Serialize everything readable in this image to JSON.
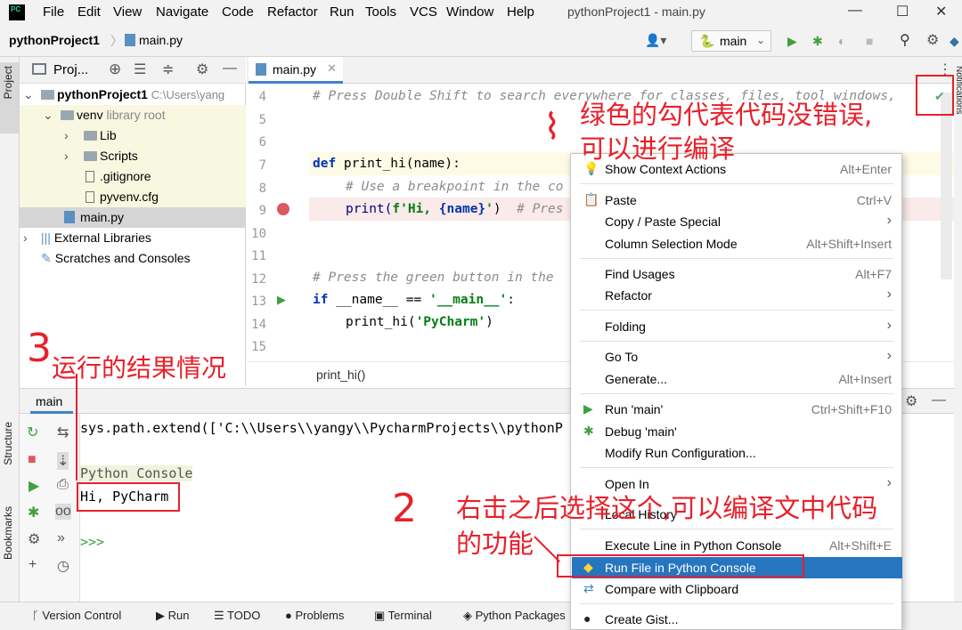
{
  "app": {
    "logo": "PC",
    "title": "pythonProject1 - main.py"
  },
  "menu": [
    "File",
    "Edit",
    "View",
    "Navigate",
    "Code",
    "Refactor",
    "Run",
    "Tools",
    "VCS",
    "Window",
    "Help"
  ],
  "window_controls": {
    "minimize": "—",
    "maximize": "☐",
    "close": "✕"
  },
  "navbar": {
    "project": "pythonProject1",
    "file": "main.py",
    "run_config": "main"
  },
  "sidebar_left": {
    "project_tab": "Project",
    "structure_tab": "Structure",
    "bookmarks_tab": "Bookmarks"
  },
  "sidebar_right": {
    "notifications_tab": "Notifications"
  },
  "project_panel": {
    "title": "Proj...",
    "tree": [
      {
        "label": "pythonProject1",
        "extra": "C:\\Users\\yang"
      },
      {
        "label": "venv",
        "extra": "library root"
      },
      {
        "label": "Lib"
      },
      {
        "label": "Scripts"
      },
      {
        "label": ".gitignore"
      },
      {
        "label": "pyvenv.cfg"
      },
      {
        "label": "main.py"
      },
      {
        "label": "External Libraries"
      },
      {
        "label": "Scratches and Consoles"
      }
    ]
  },
  "editor": {
    "tab": "main.py",
    "line_numbers": [
      "4",
      "5",
      "6",
      "7",
      "8",
      "9",
      "10",
      "11",
      "12",
      "13",
      "14",
      "15"
    ],
    "code": {
      "l4": "# Press Double Shift to search everywhere for classes, files, tool windows,",
      "l7_kw": "def ",
      "l7_rest": "print_hi(name):",
      "l8": "# Use a breakpoint in the co",
      "l9_a": "print(",
      "l9_b": "f'Hi, ",
      "l9_c": "{name}",
      "l9_d": "'",
      "l9_e": ")  ",
      "l9_f": "# Pres",
      "l12": "# Press the green button in the",
      "l13_kw": "if ",
      "l13_a": "__name__ == ",
      "l13_b": "'__main__'",
      "l13_c": ":",
      "l14_a": "print_hi(",
      "l14_b": "'PyCharm'",
      "l14_c": ")"
    },
    "breadcrumb": "print_hi()"
  },
  "run_panel": {
    "tab": "main",
    "lines": {
      "path": "sys.path.extend(['C:\\\\Users\\\\yangy\\\\PycharmProjects\\\\pythonP",
      "console_title": "Python Console",
      "output": "Hi, PyCharm",
      "prompt": ">>>"
    }
  },
  "context_menu": {
    "items": [
      {
        "label": "Show Context Actions",
        "shortcut": "Alt+Enter"
      },
      {
        "label": "Paste",
        "shortcut": "Ctrl+V"
      },
      {
        "label": "Copy / Paste Special"
      },
      {
        "label": "Column Selection Mode",
        "shortcut": "Alt+Shift+Insert"
      },
      {
        "label": "Find Usages",
        "shortcut": "Alt+F7"
      },
      {
        "label": "Refactor"
      },
      {
        "label": "Folding"
      },
      {
        "label": "Go To"
      },
      {
        "label": "Generate...",
        "shortcut": "Alt+Insert"
      },
      {
        "label": "Run 'main'",
        "shortcut": "Ctrl+Shift+F10"
      },
      {
        "label": "Debug 'main'"
      },
      {
        "label": "Modify Run Configuration..."
      },
      {
        "label": "Open In"
      },
      {
        "label": "Local History"
      },
      {
        "label": "Execute Line in Python Console",
        "shortcut": "Alt+Shift+E"
      },
      {
        "label": "Run File in Python Console"
      },
      {
        "label": "Compare with Clipboard"
      },
      {
        "label": "Create Gist..."
      }
    ]
  },
  "statusbar": {
    "items": [
      "Version Control",
      "Run",
      "TODO",
      "Problems",
      "Terminal",
      "Python Packages"
    ]
  },
  "annotations": {
    "a1_line1": "绿色的勾代表代码没错误,",
    "a1_line2": "可以进行编译",
    "a2_num": "3",
    "a2_text": "运行的结果情况",
    "a3_num": "2",
    "a3_line1": "右击之后选择这个,可以编译文中代码",
    "a3_line2": "的功能"
  },
  "colors": {
    "accent": "#2675bf",
    "annotation": "#e8202a",
    "run_green": "#3fa03f",
    "check_green": "#59a869"
  }
}
